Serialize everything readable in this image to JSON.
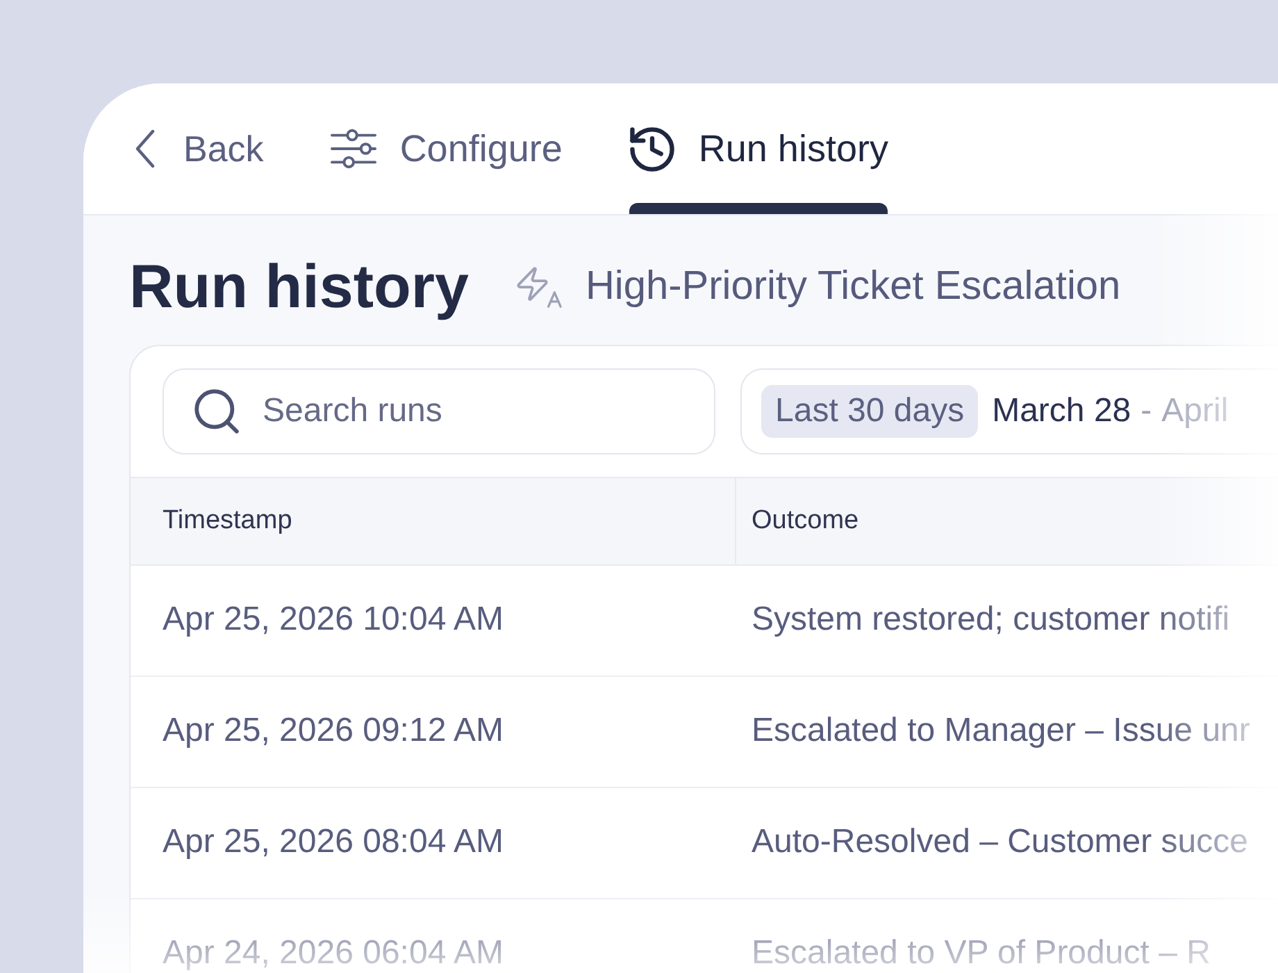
{
  "nav": {
    "back": "Back",
    "tabs": [
      {
        "label": "Configure",
        "selected": false
      },
      {
        "label": "Run history",
        "selected": true
      }
    ]
  },
  "header": {
    "title": "Run history",
    "workflow": "High-Priority Ticket Escalation"
  },
  "filters": {
    "search": {
      "placeholder": "Search runs"
    },
    "date_range": {
      "preset": "Last 30 days",
      "start": "March 28",
      "separator": "-",
      "end": "April"
    }
  },
  "table": {
    "columns": [
      "Timestamp",
      "Outcome"
    ],
    "rows": [
      {
        "timestamp": "Apr 25, 2026 10:04 AM",
        "outcome": "System restored; customer notifi"
      },
      {
        "timestamp": "Apr 25, 2026 09:12 AM",
        "outcome": "Escalated to Manager – Issue unr"
      },
      {
        "timestamp": "Apr 25, 2026 08:04 AM",
        "outcome": "Auto-Resolved – Customer succe"
      },
      {
        "timestamp": "Apr 24, 2026 06:04 AM",
        "outcome": "Escalated to VP of Product – R"
      }
    ]
  }
}
